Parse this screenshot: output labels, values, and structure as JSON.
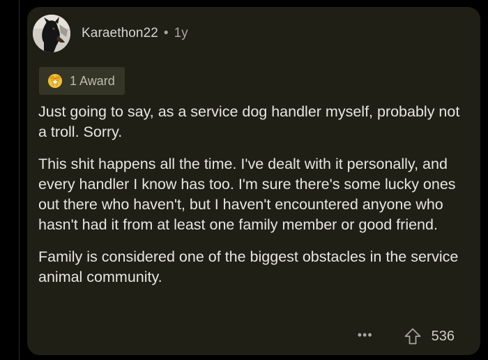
{
  "comment": {
    "author": "Karaethon22",
    "separator": "•",
    "age": "1y",
    "award": {
      "icon": "award-star-icon",
      "label": "1 Award"
    },
    "paragraphs": [
      "Just going to say, as a service dog handler myself, probably not a troll. Sorry.",
      "This shit happens all the time. I've dealt with it personally, and every handler I know has too. I'm sure there's some lucky ones out there who haven't, but I haven't encountered anyone who hasn't had it from at least one family member or good friend.",
      "Family is considered one of the biggest obstacles in the service animal community."
    ],
    "more_label": "•••",
    "upvote_icon": "upvote-arrow-icon",
    "score": "536"
  },
  "colors": {
    "background": "#000000",
    "card": "#1f1f15",
    "text": "#e8e6e0",
    "muted": "#a8a69f",
    "award_chip": "#353527",
    "award_gold": "#f2c230"
  }
}
